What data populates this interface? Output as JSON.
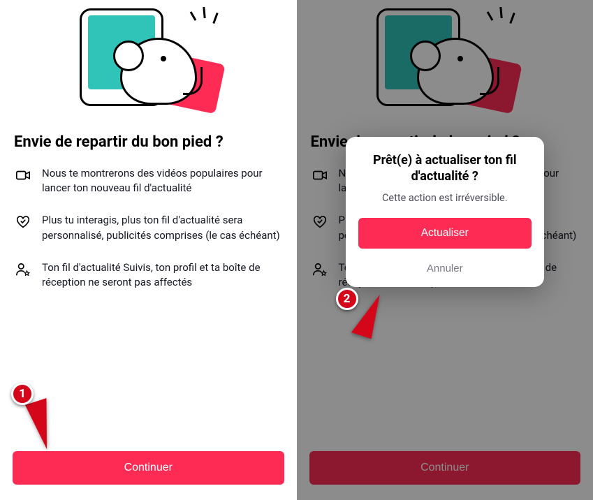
{
  "left": {
    "heading": "Envie de repartir du bon pied ?",
    "bullets": [
      "Nous te montrerons des vidéos populaires pour lancer ton nouveau fil d'actualité",
      "Plus tu interagis, plus ton fil d'actualité sera personnalisé, publicités comprises (le cas échéant)",
      "Ton fil d'actualité Suivis, ton profil et ta boîte de réception ne seront pas affectés"
    ],
    "cta": "Continuer"
  },
  "right": {
    "heading": "Envie de repartir du bon pied ?",
    "bullets": [
      "Nous te montrerons des vidéos populaires pour lancer ton nouveau fil d'actualité",
      "Plus tu interagis, plus ton fil d'actualité sera personnalisé, publicités comprises (le cas échéant)",
      "Ton fil d'actualité Suivis, ton profil et ta boîte de réception ne seront pas affectés"
    ],
    "cta": "Continuer",
    "modal": {
      "title": "Prêt(e) à actualiser ton fil d'actualité ?",
      "subtitle": "Cette action est irréversible.",
      "confirm": "Actualiser",
      "cancel": "Annuler"
    }
  },
  "markers": {
    "one": "1",
    "two": "2"
  },
  "colors": {
    "accent": "#FE2C55",
    "teal": "#30C3B8",
    "marker": "#D4061A"
  }
}
